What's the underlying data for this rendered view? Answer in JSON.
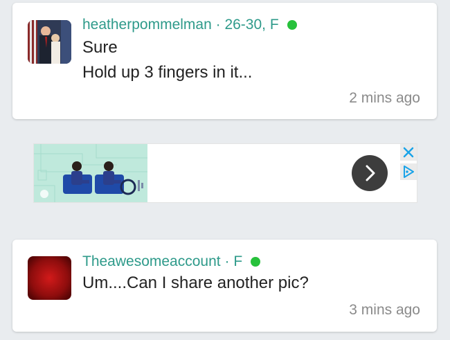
{
  "messages": [
    {
      "username": "heatherpommelman",
      "separator": "·",
      "age_sex": "26-30, F",
      "lines": [
        "Sure",
        "Hold up 3 fingers in it..."
      ],
      "time": "2 mins ago",
      "online": true
    },
    {
      "username": "Theawesomeaccount",
      "separator": "·",
      "age_sex": "F",
      "lines": [
        "Um....Can I share another pic?"
      ],
      "time": "3 mins ago",
      "online": true
    }
  ],
  "ad": {
    "next_icon": "chevron-right-icon",
    "close_icon": "close-icon",
    "choices_icon": "adchoices-icon"
  },
  "colors": {
    "username": "#2e9a8a",
    "online": "#27c13b",
    "background": "#e9ecef",
    "ad_accent": "#1aa3e8"
  }
}
